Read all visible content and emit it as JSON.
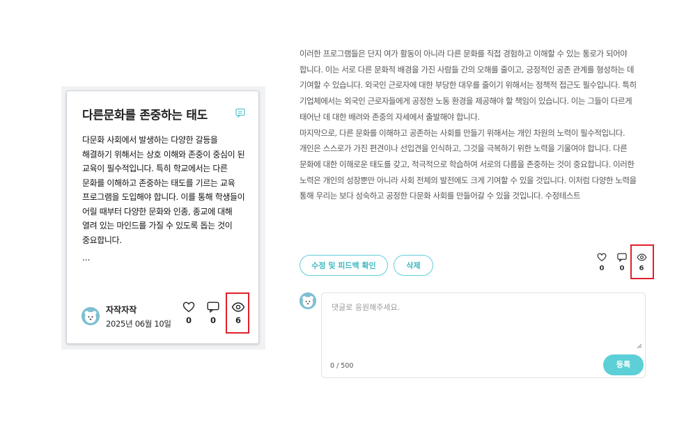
{
  "card": {
    "title": "다른문화를 존중하는 태도",
    "body": "다문화 사회에서 발생하는 다양한 갈등을 해결하기 위해서는 상호 이해와 존중이 중심이 된 교육이 필수적입니다. 특히 학교에서는 다른 문화를 이해하고 존중하는 태도를 기르는 교육 프로그램을 도입해야 합니다. 이를 통해 학생들이 어릴 때부터 다양한 문화와 인종, 종교에 대해 열려 있는 마인드를 가질 수 있도록 돕는 것이 중요합니다.",
    "ellipsis": "...",
    "author": "자작자작",
    "date": "2025년 06월 10일",
    "likes": "0",
    "comments": "0",
    "views": "6"
  },
  "article": {
    "paragraph1": "이러한 프로그램들은 단지 여가 활동이 아니라 다른 문화를 직접 경험하고 이해할 수 있는 통로가 되어야 합니다. 이는 서로 다른 문화적 배경을 가진 사람들 간의 오해를 줄이고, 긍정적인 공존 관계를 형성하는 데 기여할 수 있습니다. 외국인 근로자에 대한 부당한 대우를 줄이기 위해서는 정책적 접근도 필수입니다. 특히 기업체에서는 외국인 근로자들에게 공정한 노동 환경을 제공해야 할 책임이 있습니다. 이는 그들이 다르게 태어난 데 대한 배려와 존중의 자세에서 출발해야 합니다.",
    "paragraph2": "마지막으로, 다른 문화를 이해하고 공존하는 사회를 만들기 위해서는 개인 차원의 노력이 필수적입니다. 개인은 스스로가 가진 편견이나 선입견을 인식하고, 그것을 극복하기 위한 노력을 기울여야 합니다. 다른 문화에 대한 이해로운 태도를 갖고, 적극적으로 학습하여 서로의 다름을 존중하는 것이 중요합니다. 이러한 노력은 개인의 성장뿐만 아니라 사회 전체의 발전에도 크게 기여할 수 있을 것입니다. 이처럼 다양한 노력을 통해 우리는 보다 성숙하고 공정한 다문화 사회를 만들어갈 수 있을 것입니다. 수정테스트"
  },
  "actions": {
    "edit_label": "수정 및 피드백 확인",
    "delete_label": "삭제"
  },
  "stats": {
    "likes": "0",
    "comments": "0",
    "views": "6"
  },
  "comment": {
    "placeholder": "댓글로 응원해주세요.",
    "counter": "0 / 500",
    "submit_label": "등록"
  },
  "colors": {
    "accent": "#5cd0d6",
    "highlight": "#e0202a"
  }
}
